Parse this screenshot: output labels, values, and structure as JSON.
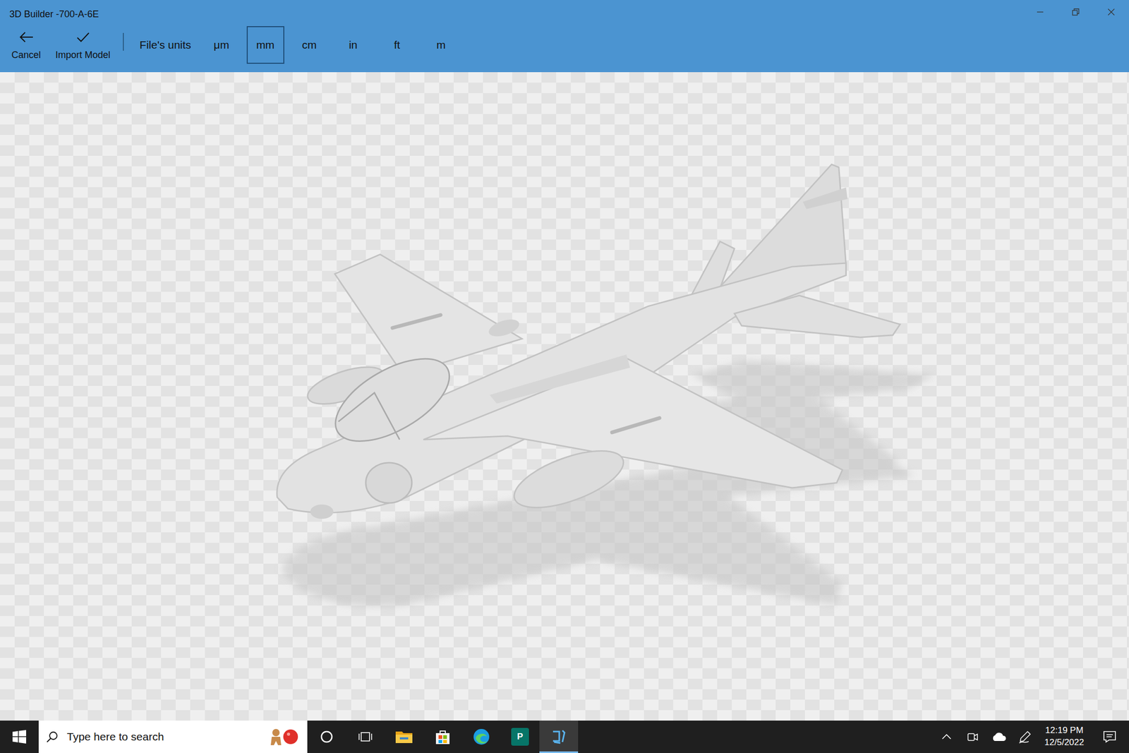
{
  "window": {
    "title": "3D Builder -700-A-6E"
  },
  "toolbar": {
    "actions": [
      {
        "label": "Cancel",
        "kind": "back"
      },
      {
        "label": "Import Model",
        "kind": "check"
      }
    ],
    "units_label": "File's units",
    "units": [
      {
        "label": "μm",
        "selected": false
      },
      {
        "label": "mm",
        "selected": true
      },
      {
        "label": "cm",
        "selected": false
      },
      {
        "label": "in",
        "selected": false
      },
      {
        "label": "ft",
        "selected": false
      },
      {
        "label": "m",
        "selected": false
      }
    ]
  },
  "taskbar": {
    "search": {
      "placeholder": "Type here to search"
    },
    "apps": [
      {
        "kind": "explorer",
        "selected": false
      },
      {
        "kind": "store",
        "selected": false
      },
      {
        "kind": "edge",
        "selected": false
      },
      {
        "kind": "publisher",
        "label": "P",
        "selected": false
      },
      {
        "kind": "builder",
        "selected": true
      }
    ],
    "clock": {
      "time": "12:19 PM",
      "date": "12/5/2022"
    }
  }
}
